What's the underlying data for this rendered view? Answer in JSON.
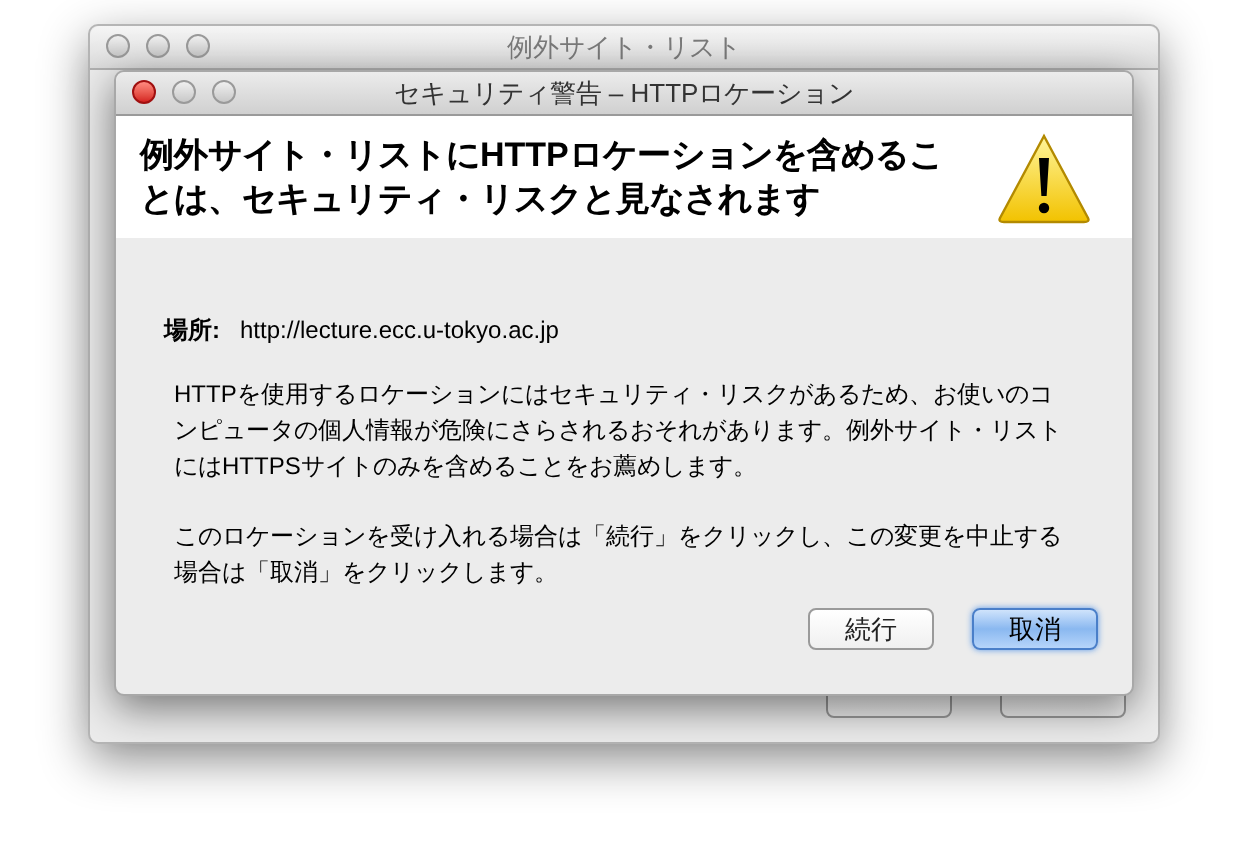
{
  "back_window": {
    "title": "例外サイト・リスト",
    "active": false,
    "buttons": [
      {
        "default": false
      },
      {
        "default": false
      }
    ]
  },
  "dialog": {
    "title": "セキュリティ警告 – HTTPロケーション",
    "active": true,
    "heading": "例外サイト・リストにHTTPロケーションを含めることは、セキュリティ・リスクと見なされます",
    "location_label": "場所:",
    "location_value": "http://lecture.ecc.u-tokyo.ac.jp",
    "paragraphs": [
      "HTTPを使用するロケーションにはセキュリティ・リスクがあるため、お使いのコンピュータの個人情報が危険にさらされるおそれがあります。例外サイト・リストにはHTTPSサイトのみを含めることをお薦めします。",
      "このロケーションを受け入れる場合は「続行」をクリックし、この変更を中止する場合は「取消」をクリックします。"
    ],
    "buttons": [
      {
        "label": "続行",
        "default": false
      },
      {
        "label": "取消",
        "default": true
      }
    ]
  }
}
